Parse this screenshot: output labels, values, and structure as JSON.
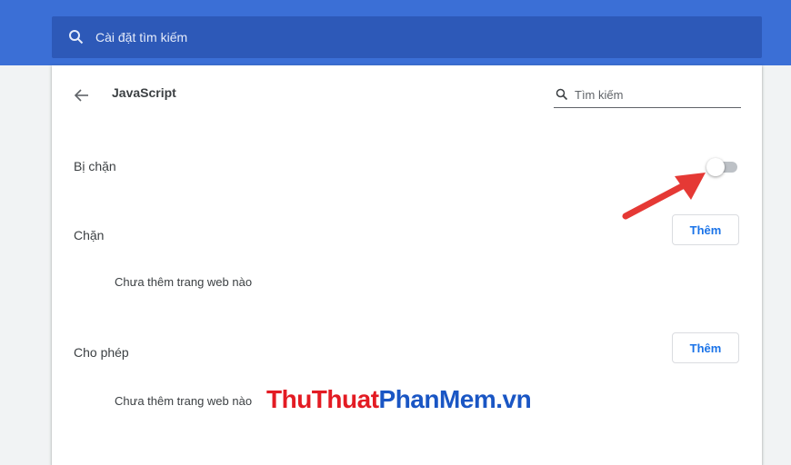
{
  "topbar": {
    "search_placeholder": "Cài đặt tìm kiếm"
  },
  "page": {
    "title": "JavaScript",
    "search_placeholder": "Tìm kiếm"
  },
  "setting": {
    "label": "Bị chặn",
    "toggle_on": false
  },
  "block_section": {
    "heading": "Chặn",
    "add_label": "Thêm",
    "empty_text": "Chưa thêm trang web nào"
  },
  "allow_section": {
    "heading": "Cho phép",
    "add_label": "Thêm",
    "empty_text": "Chưa thêm trang web nào"
  },
  "watermark": {
    "part1": "ThuThuat",
    "part2": "PhanMem.vn"
  },
  "colors": {
    "header_blue": "#3b6fd6",
    "search_blue": "#2d59b8",
    "accent": "#1a73e8",
    "annotation_red": "#e53935"
  }
}
